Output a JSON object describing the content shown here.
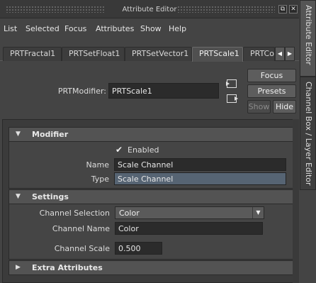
{
  "window": {
    "title": "Attribute Editor",
    "float_button": "⧉",
    "close_button": "✕"
  },
  "menu": [
    "List",
    "Selected",
    "Focus",
    "Attributes",
    "Show",
    "Help"
  ],
  "tabs": [
    {
      "label": "PRTFractal1",
      "active": false
    },
    {
      "label": "PRTSetFloat1",
      "active": false
    },
    {
      "label": "PRTSetVector1",
      "active": false
    },
    {
      "label": "PRTScale1",
      "active": true
    },
    {
      "label": "PRTCo",
      "active": false
    }
  ],
  "tab_scroll": {
    "left_icon": "◀",
    "right_icon": "▶"
  },
  "node": {
    "label": "PRTModifier:",
    "value": "PRTScale1"
  },
  "buttons": {
    "focus": "Focus",
    "presets": "Presets",
    "show": "Show",
    "hide": "Hide"
  },
  "sections": {
    "modifier": {
      "title": "Modifier",
      "expand_icon": "▼",
      "enabled_check": "✔",
      "enabled_label": "Enabled",
      "name_label": "Name",
      "name_value": "Scale Channel",
      "type_label": "Type",
      "type_value": "Scale Channel"
    },
    "settings": {
      "title": "Settings",
      "expand_icon": "▼",
      "channel_selection_label": "Channel Selection",
      "channel_selection_value": "Color",
      "dropdown_icon": "▼",
      "channel_name_label": "Channel Name",
      "channel_name_value": "Color",
      "channel_scale_label": "Channel Scale",
      "channel_scale_value": "0.500"
    },
    "extra": {
      "title": "Extra Attributes",
      "expand_icon": "▶"
    }
  },
  "side_tabs": [
    "Attribute Editor",
    "Channel Box / Layer Editor"
  ]
}
